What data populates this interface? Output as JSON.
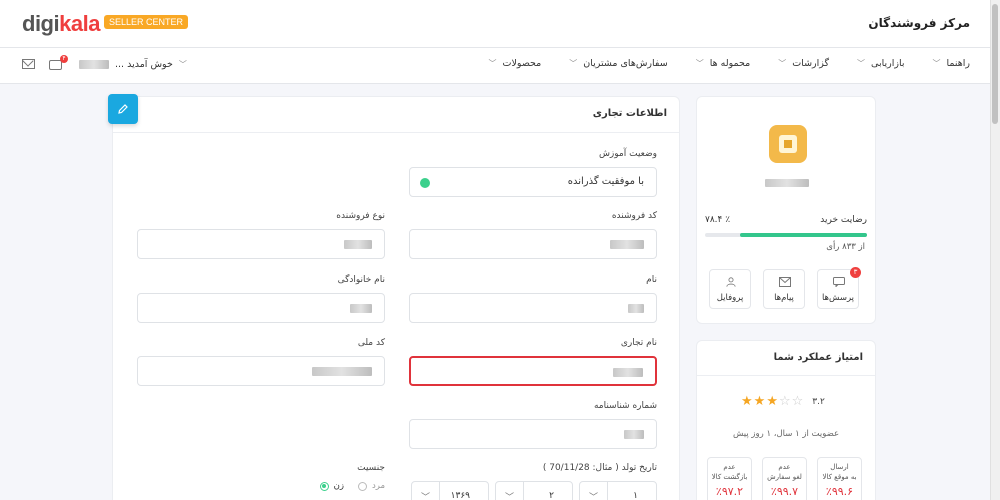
{
  "brand": {
    "logo_part1": "digi",
    "logo_part2": "kala",
    "badge": "SELLER CENTER"
  },
  "header": {
    "site_title": "مرکز فروشندگان"
  },
  "nav": {
    "items": [
      "محصولات",
      "سفارش‌های مشتریان",
      "محموله ها",
      "گزارشات",
      "بازاریابی",
      "راهنما"
    ],
    "welcome": "خوش آمدید ...",
    "notif_count": "۴"
  },
  "main": {
    "title": "اطلاعات تجاری",
    "training_status": {
      "label": "وضعیت آموزش",
      "value": "با موفقیت گذرانده"
    },
    "seller_code": {
      "label": "کد فروشنده"
    },
    "seller_type": {
      "label": "نوع فروشنده"
    },
    "first_name": {
      "label": "نام"
    },
    "last_name": {
      "label": "نام خانوادگی"
    },
    "trade_name": {
      "label": "نام تجاری"
    },
    "national_id": {
      "label": "کد ملی"
    },
    "id_number": {
      "label": "شماره شناسنامه"
    },
    "birth_date": {
      "label": "تاریخ تولد ( مثال: 70/11/28 )",
      "day": "۱",
      "month": "۲",
      "year": "۱۳۶۹"
    },
    "gender": {
      "label": "جنسیت",
      "options": [
        "زن",
        "مرد"
      ],
      "selected": "زن"
    }
  },
  "profile": {
    "rating_label": "رضایت خرید",
    "rating_value": "٪ ۷۸.۴",
    "rating_percent": 78.4,
    "votes": "از ۸۳۳ رأی",
    "actions": [
      {
        "label": "پرسش‌ها",
        "icon": "chat-icon",
        "badge": "۳"
      },
      {
        "label": "پیام‌ها",
        "icon": "mail-icon"
      },
      {
        "label": "پروفایل",
        "icon": "user-icon"
      }
    ]
  },
  "performance": {
    "title": "امتیاز عملکرد شما",
    "score": "۳.۲",
    "stars_filled": 3,
    "stars_total": 5,
    "membership": "عضویت از ۱ سال، ۱ روز پیش",
    "metrics": [
      {
        "label1": "ارسال",
        "label2": "به موقع کالا",
        "value": "٪۹۹.۶"
      },
      {
        "label1": "عدم",
        "label2": "لغو سفارش",
        "value": "٪۹۹.۷"
      },
      {
        "label1": "عدم",
        "label2": "بازگشت کالا",
        "value": "٪۹۷.۲"
      }
    ]
  },
  "colors": {
    "accent": "#1aa8e0",
    "brand_red": "#ef3f3e",
    "success": "#3bd08c",
    "error": "#e0333b",
    "star": "#f5a623"
  }
}
